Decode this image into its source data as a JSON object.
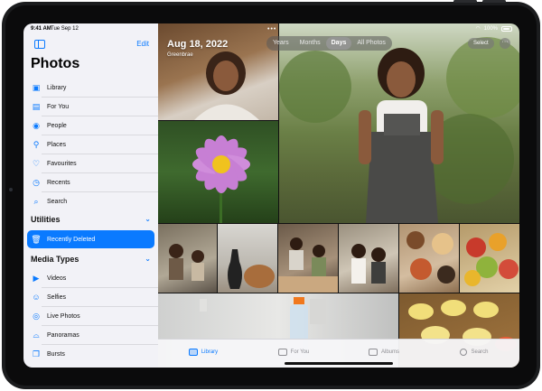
{
  "status": {
    "time": "9:41 AM",
    "date": "Tue Sep 12"
  },
  "sidebar": {
    "title": "Photos",
    "edit_label": "Edit",
    "items": [
      {
        "label": "Library",
        "icon": "library-icon"
      },
      {
        "label": "For You",
        "icon": "for-you-icon"
      },
      {
        "label": "People",
        "icon": "people-icon"
      },
      {
        "label": "Places",
        "icon": "places-icon"
      },
      {
        "label": "Favourites",
        "icon": "heart-icon"
      },
      {
        "label": "Recents",
        "icon": "recents-icon"
      },
      {
        "label": "Search",
        "icon": "search-icon"
      }
    ],
    "utilities": {
      "title": "Utilities",
      "items": [
        {
          "label": "Recently Deleted",
          "icon": "trash-icon",
          "selected": true
        }
      ]
    },
    "media_types": {
      "title": "Media Types",
      "items": [
        {
          "label": "Videos",
          "icon": "video-icon"
        },
        {
          "label": "Selfies",
          "icon": "selfie-icon"
        },
        {
          "label": "Live Photos",
          "icon": "live-photo-icon"
        },
        {
          "label": "Panoramas",
          "icon": "panorama-icon"
        },
        {
          "label": "Bursts",
          "icon": "bursts-icon"
        }
      ]
    }
  },
  "main": {
    "date_title": "Aug 18, 2022",
    "location": "Greenbrae",
    "segments": [
      {
        "label": "Years",
        "active": false
      },
      {
        "label": "Months",
        "active": false
      },
      {
        "label": "Days",
        "active": true
      },
      {
        "label": "All Photos",
        "active": false
      }
    ],
    "select_label": "Select",
    "more_label": "···"
  },
  "tabbar": {
    "tabs": [
      {
        "label": "Library",
        "active": true
      },
      {
        "label": "For You",
        "active": false
      },
      {
        "label": "Albums",
        "active": false
      },
      {
        "label": "Search",
        "active": false
      }
    ]
  },
  "colors": {
    "accent": "#0a7aff",
    "sidebar_bg": "#f2f2f7"
  }
}
